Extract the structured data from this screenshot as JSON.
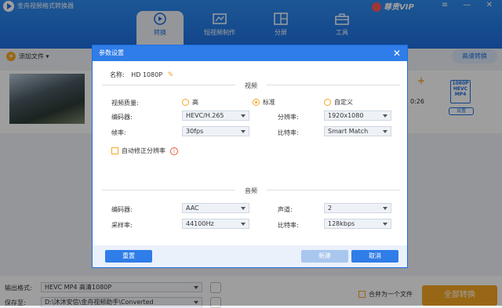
{
  "app": {
    "title": "金舟视频格式转换器"
  },
  "vip": {
    "label": "尊贵VIP"
  },
  "window_controls": {
    "text": "≡ — ✕"
  },
  "tabs": [
    {
      "label": "转换",
      "icon": "convert-icon",
      "active": true
    },
    {
      "label": "短视频制作",
      "icon": "film-icon",
      "active": false
    },
    {
      "label": "分屏",
      "icon": "split-screen-icon",
      "active": false
    },
    {
      "label": "工具",
      "icon": "toolbox-icon",
      "active": false
    }
  ],
  "toolbar": {
    "add_file": "添加文件 ▾",
    "speed": "高速转换"
  },
  "file": {
    "duration": "0:26",
    "format_badge_top": "1080P",
    "format_badge": "HEVC",
    "format_badge_sub": "MP4",
    "settings": "设置"
  },
  "bottom": {
    "output_format_label": "输出格式:",
    "output_format_value": "HEVC MP4 高清1080P",
    "save_to_label": "保存至:",
    "save_to_value": "D:\\沐沐安信\\金舟视频助手\\Converted",
    "merge_label": "合并为一个文件",
    "convert_all": "全部转换"
  },
  "modal": {
    "title": "参数设置",
    "close": "✕",
    "name_label": "名称:",
    "name_value": "HD 1080P",
    "video_section": "视频",
    "audio_section": "音频",
    "quality_label": "视频质量:",
    "quality_options": [
      {
        "label": "高",
        "selected": false
      },
      {
        "label": "标准",
        "selected": true
      },
      {
        "label": "自定义",
        "selected": false
      }
    ],
    "video_encoder_label": "编码器:",
    "video_encoder_value": "HEVC/H.265",
    "resolution_label": "分辨率:",
    "resolution_value": "1920x1080",
    "framerate_label": "帧率:",
    "framerate_value": "30fps",
    "bitrate_label": "比特率:",
    "bitrate_value": "Smart Match",
    "auto_fix_label": "自动修正分辨率",
    "audio_encoder_label": "编码器:",
    "audio_encoder_value": "AAC",
    "channel_label": "声道:",
    "channel_value": "2",
    "samplerate_label": "采样率:",
    "samplerate_value": "44100Hz",
    "audio_bitrate_label": "比特率:",
    "audio_bitrate_value": "128kbps",
    "reset": "重置",
    "new": "新建",
    "cancel": "取消"
  },
  "colors": {
    "primary": "#1d6fe0",
    "accent": "#f5a623"
  }
}
